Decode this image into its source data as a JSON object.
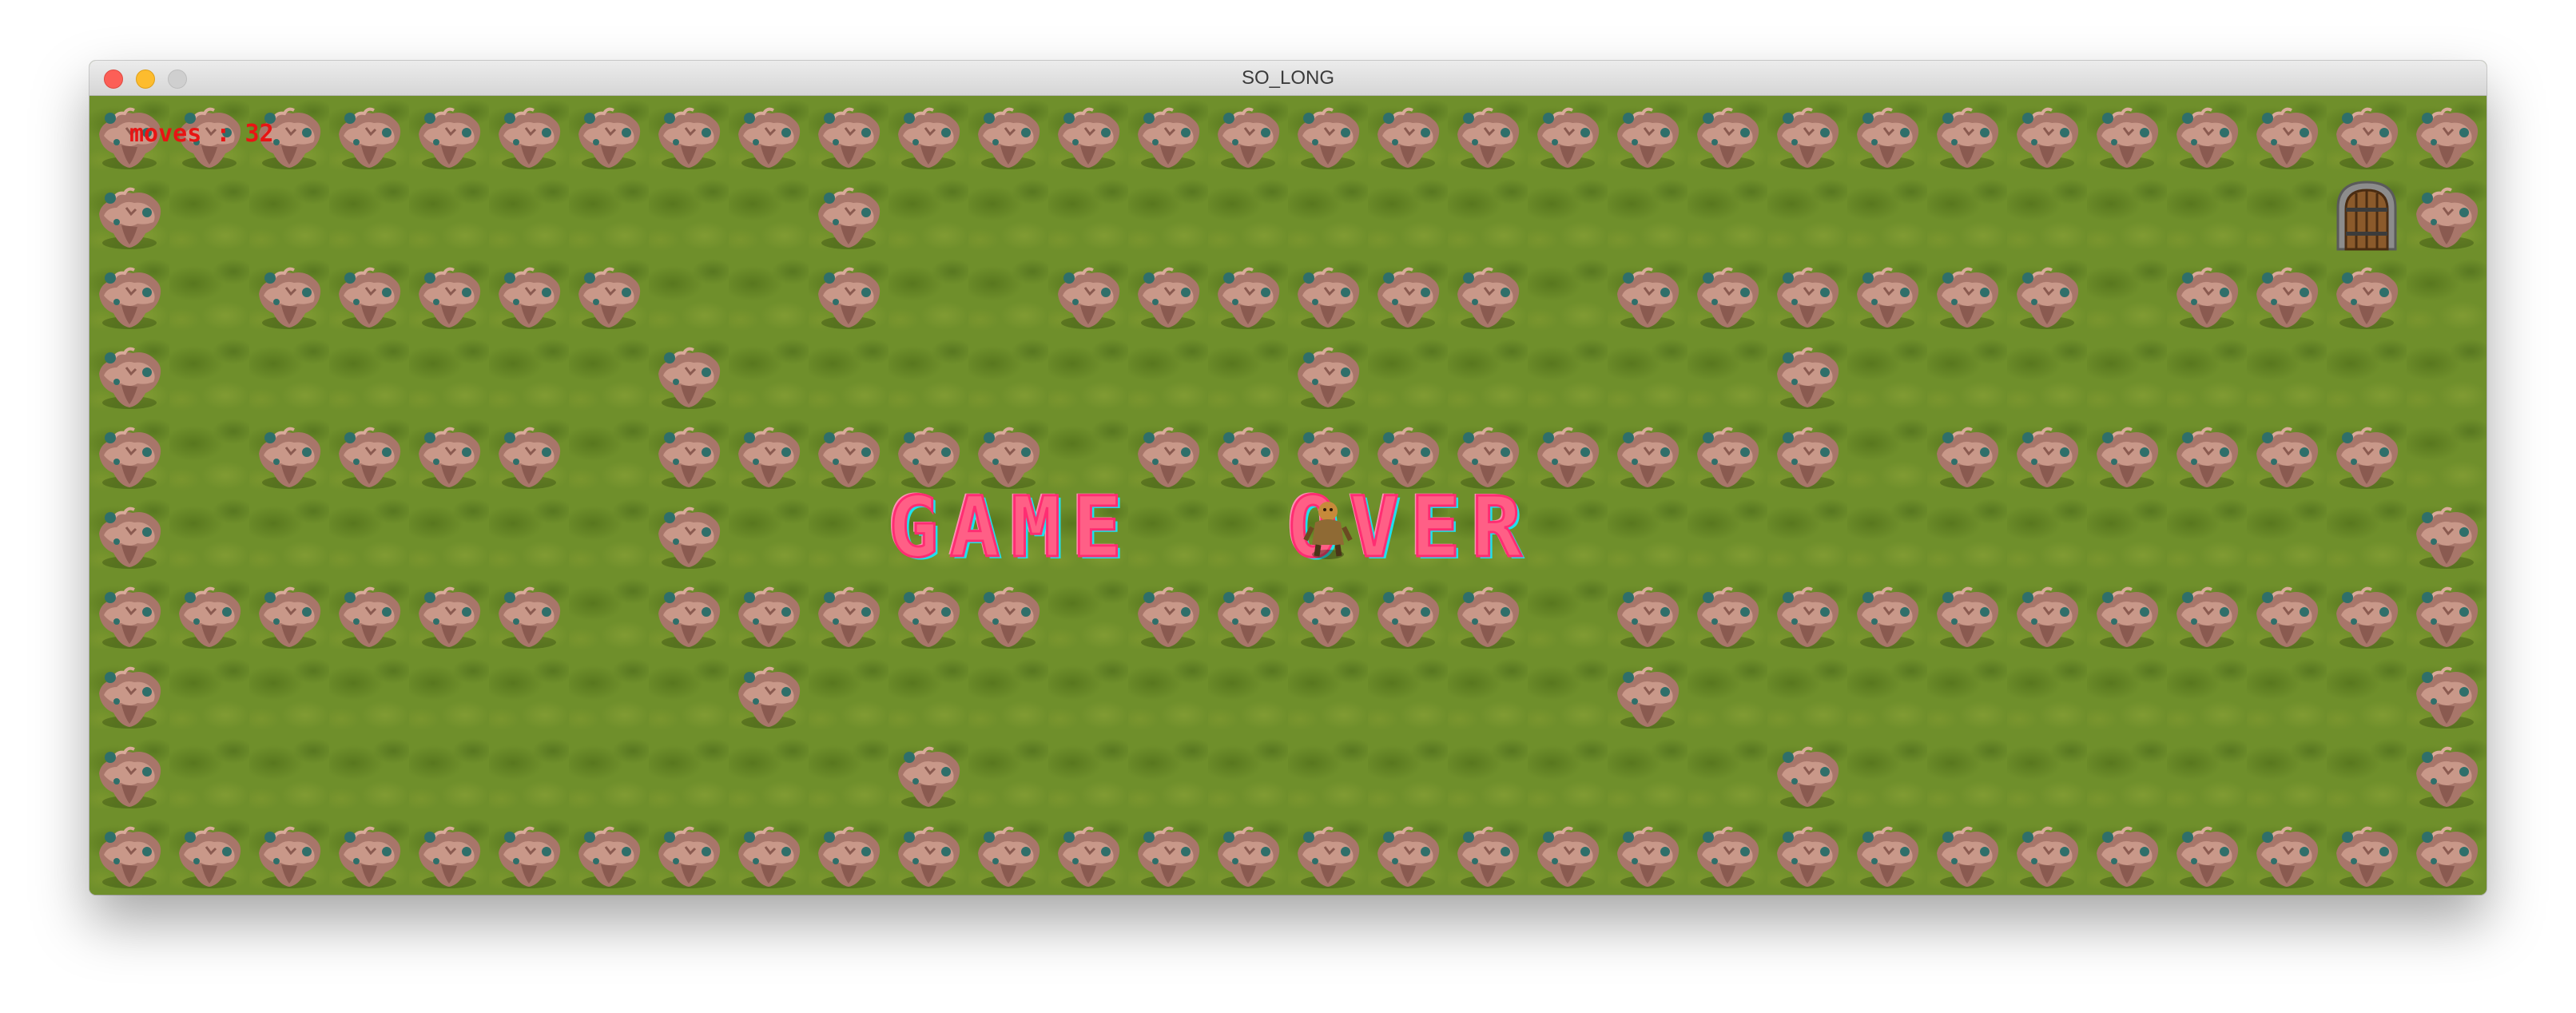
{
  "window": {
    "title": "SO_LONG"
  },
  "hud": {
    "moves_text": "moves : 32"
  },
  "overlay": {
    "word_left": "GAME",
    "word_right": "OVER"
  },
  "map": {
    "grid": [
      "111111111111111111111111111111",
      "1000000001000000000000000000E1",
      "1011111001001111110111111011101",
      "1000000100000001000001000000001",
      "1011110111110111111111011111101",
      "100000010000000P00000000000001",
      "111111011111011111011111111111",
      "100000001000000000010000000001",
      "100000000010000000000100000001",
      "111111111111111111111111111111"
    ]
  },
  "colors": {
    "grass": "#6f8f2b",
    "moves_text": "#e81414",
    "game_over_fill": "#ff5f86",
    "game_over_glow": "#1fe0ef"
  },
  "icons": {
    "wall": "rock-island-icon",
    "exit": "wooden-door-icon",
    "player": "adventurer-icon"
  }
}
